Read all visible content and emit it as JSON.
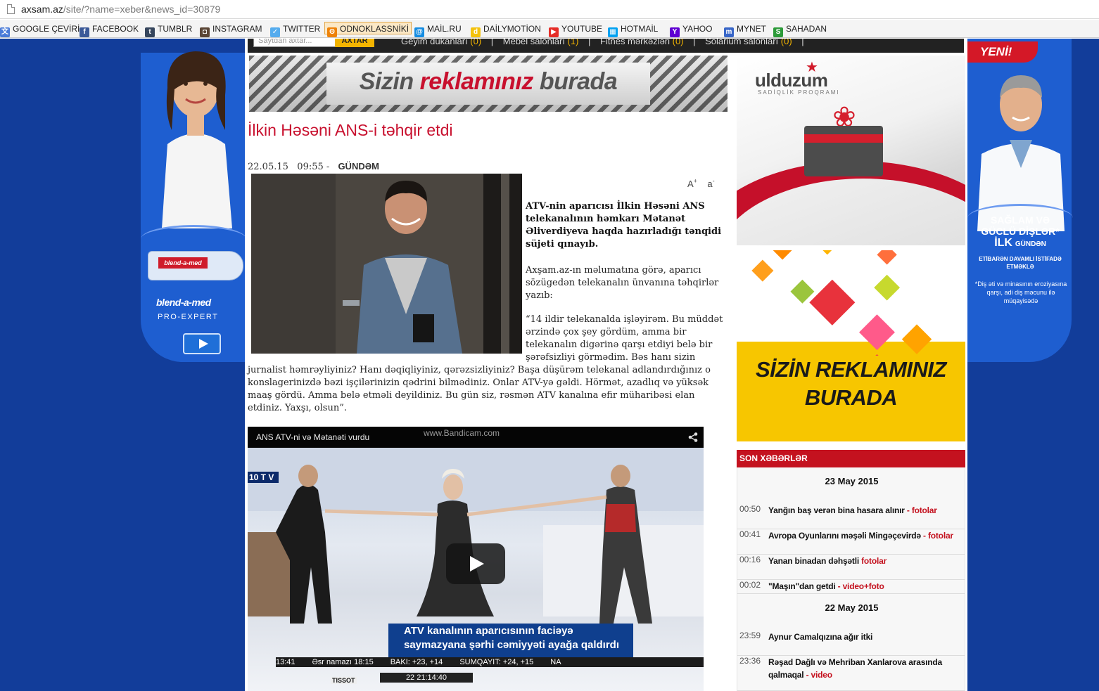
{
  "browser": {
    "url_host": "axsam.az",
    "url_path": "/site/?name=xeber&news_id=30879"
  },
  "bookmarks": [
    {
      "label": "GOOGLE ÇEVİRİ",
      "icon": "translate-icon",
      "color": "#4a7bd8"
    },
    {
      "label": "FACEBOOK",
      "icon": "facebook-icon",
      "color": "#3b5998"
    },
    {
      "label": "TUMBLR",
      "icon": "tumblr-icon",
      "color": "#36465d"
    },
    {
      "label": "INSTAGRAM",
      "icon": "instagram-icon",
      "color": "#5b4636"
    },
    {
      "label": "TWITTER",
      "icon": "twitter-icon",
      "color": "#55acee"
    },
    {
      "label": "ODNOKLASSNİKİ",
      "icon": "odnoklassniki-icon",
      "color": "#ee8208"
    },
    {
      "label": "MAİL.RU",
      "icon": "mailru-icon",
      "color": "#168de2"
    },
    {
      "label": "DAİLYMOTİON",
      "icon": "dailymotion-icon",
      "color": "#f4c20d"
    },
    {
      "label": "YOUTUBE",
      "icon": "youtube-icon",
      "color": "#e52d27"
    },
    {
      "label": "HOTMAİL",
      "icon": "windows-icon",
      "color": "#00a1f1"
    },
    {
      "label": "YAHOO",
      "icon": "yahoo-icon",
      "color": "#5f01d1"
    },
    {
      "label": "MYNET",
      "icon": "mynet-icon",
      "color": "#3866c8"
    },
    {
      "label": "SAHADAN",
      "icon": "sahadan-icon",
      "color": "#2d9b3a"
    }
  ],
  "topnav": {
    "search_placeholder": "Saytdan axtar...",
    "search_button": "AXTAR",
    "links": [
      {
        "label": "Geyim dükanları",
        "count": "(0)"
      },
      {
        "label": "Mebel salonları",
        "count": "(1)"
      },
      {
        "label": "Fitnes mərkəzləri",
        "count": "(0)"
      },
      {
        "label": "Solarium salonları",
        "count": "(0)"
      }
    ]
  },
  "banner": {
    "word1": "Sizin ",
    "word2": "reklamınız",
    "word3": " burada"
  },
  "article": {
    "title": "İlkin Həsəni ANS-i təhqir etdi",
    "date": "22.05.15",
    "time": "09:55 -",
    "category": "GÜNDƏM",
    "font_up": "A",
    "font_up_sign": "+",
    "font_down": "a",
    "font_down_sign": "-",
    "lead": "ATV-nin aparıcısı İlkin Həsəni ANS telekanalının həmkarı Mətanət Əliverdiyeva haqda hazırladığı tənqidi süjeti qınayıb.",
    "p1": "Axşam.az-ın məlumatına görə, aparıcı sözügedən telekanalın ünvanına təhqirlər yazıb:",
    "p2": "“14 ildir telekanalda işləyirəm. Bu müddət ərzində çox şey gördüm, amma bir telekanalın digərinə qarşı etdiyi belə bir şərəfsizliyi görmədim. Bəs hanı sizin",
    "p3": "jurnalist həmrəyliyiniz? Hanı dəqiqliyiniz, qərəzsizliyiniz? Başa düşürəm telekanal adlandırdığınız o konslagerinizdə bəzi işçilərinizin qədrini bilmədiniz. Onlar ATV-yə gəldi. Hörmət, azadlıq və yüksək maaş gördü. Amma belə etməli deyildiniz. Bu gün siz, rəsmən ATV kanalına efir müharibəsi elan etdiniz. Yaxşı, olsun”."
  },
  "video": {
    "title": "ANS ATV-ni və Mətanəti vurdu",
    "watermark": "www.Bandicam.com",
    "channel": "10 T V",
    "caption1": "ATV kanalının aparıcısının faciəyə",
    "caption2": "saymazyana şərhi cəmiyyəti ayağa qaldırdı",
    "ticker": [
      "13:41",
      "Əsr namazı 18:15",
      "BAKI: +23, +14",
      "SUMQAYIT: +24, +15",
      "NA"
    ],
    "clock": "22 21:14:40",
    "sponsor": "TISSOT"
  },
  "ad_left": {
    "brand": "blend-a-med",
    "sub": "PRO-EXPERT",
    "tube_label": "blend-a-med"
  },
  "ad_right": {
    "badge": "YENİ!",
    "line1": "SAĞLAM VƏ",
    "line2": "GÜCLÜ DİŞLƏR*",
    "line3": "İLK",
    "line3b": "GÜNDƏN",
    "line4": "ETİBARƏN DAVAMLI İSTİFADƏ ETMƏKLƏ",
    "note": "*Diş əti və minasının eroziyasına qarşı, adi diş məcunu ilə müqayisədə"
  },
  "ad_ulduzum": {
    "logo": "ulduzum",
    "tagline": "SADİQLİK PROQRAMI"
  },
  "ad_yellow": {
    "line1": "SİZİN REKLAMINIZ",
    "line2": "BURADA"
  },
  "son_xeberler": {
    "heading": "SON XƏBƏRLƏR",
    "groups": [
      {
        "date": "23 May 2015",
        "items": [
          {
            "time": "00:50",
            "headline": "Yanğın baş verən bina hasara alınır",
            "tag": "- fotolar"
          },
          {
            "time": "00:41",
            "headline": "Avropa Oyunlarını məşəli Mingəçevirdə",
            "tag": "- fotolar"
          },
          {
            "time": "00:16",
            "headline": "Yanan binadan dəhşətli",
            "tag": "fotolar"
          },
          {
            "time": "00:02",
            "headline": "\"Maşın\"dan getdi",
            "tag": "- video+foto"
          }
        ]
      },
      {
        "date": "22 May 2015",
        "items": [
          {
            "time": "23:59",
            "headline": "Aynur Camalqızına ağır itki",
            "tag": ""
          },
          {
            "time": "23:36",
            "headline": "Rəşad Dağlı və Mehriban Xanlarova arasında qalmaqal",
            "tag": "- video"
          }
        ]
      }
    ]
  }
}
